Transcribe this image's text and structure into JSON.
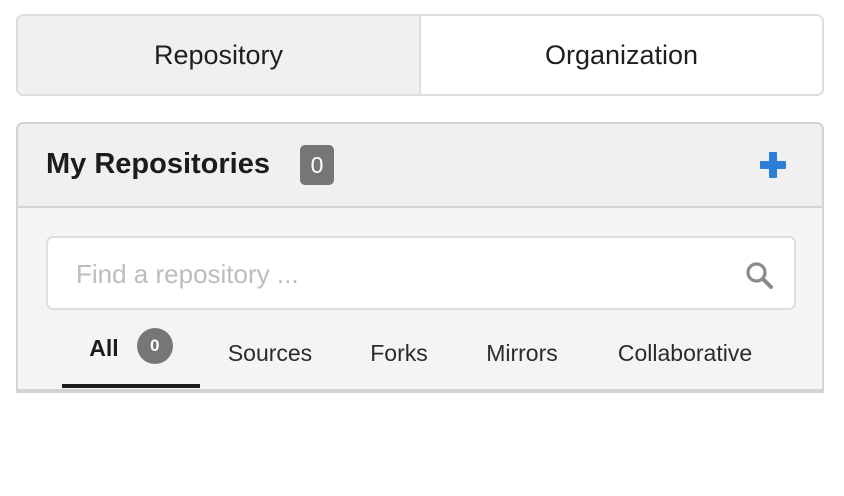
{
  "top_tabs": [
    {
      "label": "Repository",
      "active": true
    },
    {
      "label": "Organization",
      "active": false
    }
  ],
  "panel": {
    "title": "My Repositories",
    "count": "0",
    "add_icon": "plus-icon",
    "accent_color": "#2185d0"
  },
  "search": {
    "placeholder": "Find a repository ...",
    "value": "",
    "icon": "search-icon"
  },
  "filter_tabs": [
    {
      "label": "All",
      "count": "0",
      "active": true
    },
    {
      "label": "Sources",
      "active": false
    },
    {
      "label": "Forks",
      "active": false
    },
    {
      "label": "Mirrors",
      "active": false
    },
    {
      "label": "Collaborative",
      "active": false
    }
  ]
}
